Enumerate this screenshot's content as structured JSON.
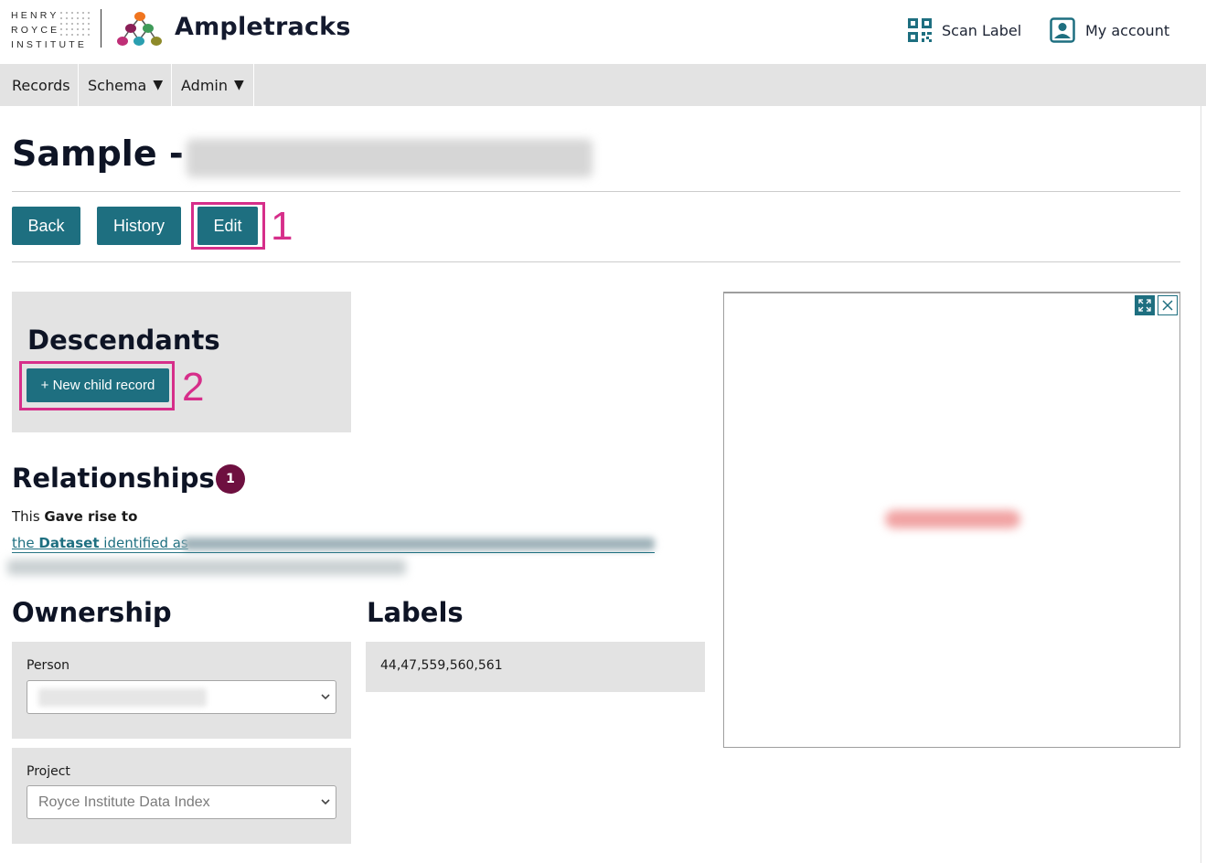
{
  "header": {
    "institute_logo": [
      "HENRY",
      "ROYCE",
      "INSTITUTE"
    ],
    "brand_name": "Ampletracks",
    "scan_label": "Scan Label",
    "my_account": "My account"
  },
  "nav": {
    "items": [
      {
        "label": "Records",
        "has_caret": false
      },
      {
        "label": "Schema",
        "has_caret": true
      },
      {
        "label": "Admin",
        "has_caret": true
      }
    ],
    "caret": "▼"
  },
  "page": {
    "title": "Sample -"
  },
  "actions": {
    "back": "Back",
    "history": "History",
    "edit": "Edit"
  },
  "annotations": {
    "edit_marker": "1",
    "new_child_marker": "2",
    "color": "#d62e8a"
  },
  "descendants": {
    "heading": "Descendants",
    "new_child_button": "+ New child record"
  },
  "relationships": {
    "heading": "Relationships",
    "count": "1",
    "line1_prefix": "This ",
    "line1_bold": "Gave rise to",
    "link_prefix": "the ",
    "link_bold": "Dataset",
    "link_suffix": " identified as"
  },
  "ownership": {
    "heading": "Ownership",
    "person_label": "Person",
    "project_label": "Project",
    "project_value": "Royce Institute Data Index"
  },
  "labels": {
    "heading": "Labels",
    "value": "44,47,559,560,561"
  },
  "colors": {
    "primary": "#1e6f80",
    "badge": "#6e1040",
    "panel_bg": "#e3e3e3",
    "heading": "#0e1425"
  },
  "icons": {
    "scan": "qr-code-icon",
    "account": "user-icon",
    "expand": "expand-icon",
    "close": "close-icon",
    "select": "chevron-down-icon"
  }
}
